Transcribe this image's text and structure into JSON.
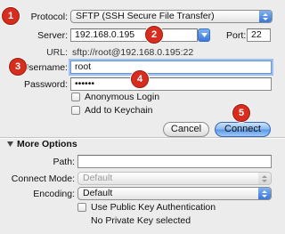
{
  "colors": {
    "badge": "#d62d1e",
    "accent": "#3a78d8",
    "window_bg": "#ececec"
  },
  "badges": [
    "1",
    "2",
    "3",
    "4",
    "5"
  ],
  "connection": {
    "protocol_label": "Protocol:",
    "protocol_value": "SFTP (SSH Secure File Transfer)",
    "server_label": "Server:",
    "server_value": "192.168.0.195",
    "port_label": "Port:",
    "port_value": "22",
    "url_label": "URL:",
    "url_value": "sftp://root@192.168.0.195:22",
    "username_label": "Username:",
    "username_value": "root",
    "password_label": "Password:",
    "password_value": "••••••",
    "anonymous_login_label": "Anonymous Login",
    "add_keychain_label": "Add to Keychain"
  },
  "buttons": {
    "cancel": "Cancel",
    "connect": "Connect"
  },
  "more_options": {
    "title": "More Options",
    "path_label": "Path:",
    "path_value": "",
    "connect_mode_label": "Connect Mode:",
    "connect_mode_value": "Default",
    "encoding_label": "Encoding:",
    "encoding_value": "Default",
    "public_key_label": "Use Public Key Authentication",
    "private_key_status": "No Private Key selected"
  },
  "icons": {
    "popup": "up-down-arrows-icon",
    "combo": "chevron-down-icon",
    "disclosure": "disclosure-triangle-down-icon"
  }
}
